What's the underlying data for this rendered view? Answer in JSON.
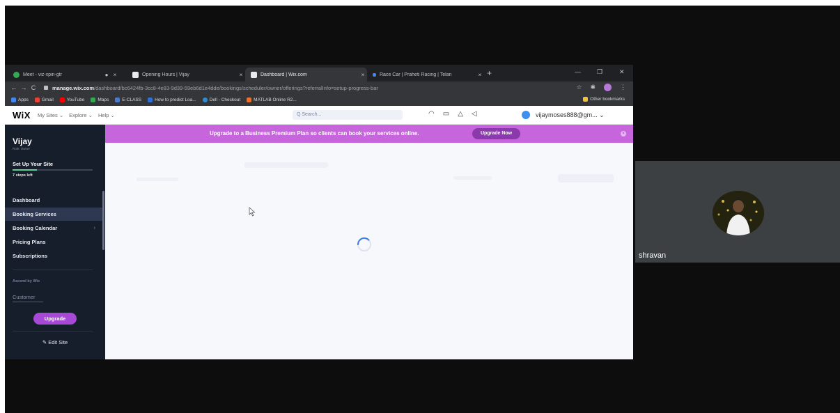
{
  "browser": {
    "tabs": [
      {
        "title": "Meet - viz-xpin-gtr",
        "favicon_color": "#34a853",
        "active": false
      },
      {
        "title": "Opening Hours | Vijay",
        "favicon_color": "#2b2b2b",
        "active": false
      },
      {
        "title": "Dashboard | Wix.com",
        "favicon_color": "#2b2b2b",
        "active": true
      },
      {
        "title": "Race Car | Praheti Racing | Telan",
        "favicon_color": "#4285f4",
        "active": false
      }
    ],
    "new_tab": "+",
    "url_domain": "manage.wix.com",
    "url_path": "/dashboard/bc6424fb-3cc8-4e83-9d39-59eb6d1e4dde/bookings/scheduler/owner/offerings?referralInfo=setup-progress-bar",
    "bookmarks": [
      {
        "label": "Apps",
        "color": "#4285f4"
      },
      {
        "label": "Gmail",
        "color": "#ea4335"
      },
      {
        "label": "YouTube",
        "color": "#ff0000"
      },
      {
        "label": "Maps",
        "color": "#34a853"
      },
      {
        "label": "E-CLASS",
        "color": "#4a7bd0"
      },
      {
        "label": "How to predict Loa...",
        "color": "#2f6fd6"
      },
      {
        "label": "Dell - Checkout",
        "color": "#2a8bd6"
      },
      {
        "label": "MATLAB Online R2...",
        "color": "#e8722a"
      }
    ],
    "other_bookmarks": "Other bookmarks"
  },
  "wix": {
    "logo": "WiX",
    "nav": [
      "My Sites ⌄",
      "Explore ⌄",
      "Help ⌄"
    ],
    "search_placeholder": "Q Search...",
    "user_email": "vijaymoses888@gm... ⌄",
    "banner_text": "Upgrade to a Business Premium Plan so clients can book your services online.",
    "banner_button": "Upgrade Now",
    "sidebar": {
      "site_name": "Vijay",
      "role": "Role: Owner",
      "setup_title": "Set Up Your Site",
      "setup_progress": 0.3,
      "steps_left": "7 steps left",
      "items": [
        {
          "label": "Dashboard",
          "active": false,
          "chevron": false
        },
        {
          "label": "Booking Services",
          "active": true,
          "chevron": false
        },
        {
          "label": "Booking Calendar",
          "active": false,
          "chevron": true
        },
        {
          "label": "Pricing Plans",
          "active": false,
          "chevron": false
        },
        {
          "label": "Subscriptions",
          "active": false,
          "chevron": false
        }
      ],
      "section_label": "Ascend by Wix",
      "customer_label": "Customer",
      "upgrade_button": "Upgrade",
      "edit_site": "✎ Edit Site"
    }
  },
  "meet": {
    "participant_name": "shravan"
  }
}
